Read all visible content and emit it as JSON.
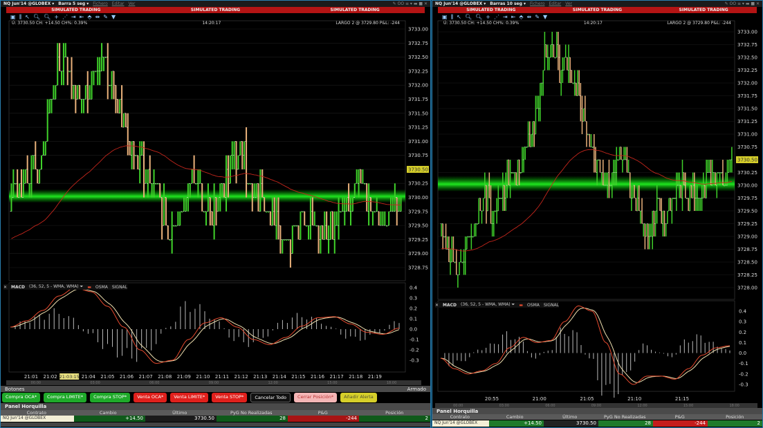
{
  "left": {
    "symbol": "NQ Jun'14 @GLOBEX ▾",
    "bar_size": "Barra 5 seg ▾",
    "menus": [
      "Fichero",
      "Editar",
      "Ver"
    ],
    "window_controls": "✎ OO ≡ ▾ ▬ ■ ✕",
    "sim_labels": [
      "SIMULATED TRADING",
      "SIMULATED TRADING",
      "SIMULATED TRADING"
    ],
    "info_quote": "Ú: 3730.50 CH: +14.50 CH%: 0.39%",
    "info_time": "14:20:17",
    "info_position": "LARGO 2 @ 3729.80  P&L: -244",
    "price_ticks": [
      "3733.00",
      "3732.75",
      "3732.50",
      "3732.25",
      "3732.00",
      "3731.75",
      "3731.50",
      "3731.25",
      "3731.00",
      "3730.75",
      "3730.50",
      "3730.25",
      "3730.00",
      "3729.75",
      "3729.50",
      "3729.25",
      "3729.00",
      "3728.75"
    ],
    "last_price_tag": "3730.50",
    "macd_ticks": [
      "0.4",
      "0.3",
      "0.2",
      "0.1",
      "0.0",
      "-0.1",
      "-0.2",
      "-0.3"
    ],
    "time_ticks": [
      "21:01",
      "21:02",
      "21:03:15",
      "21:04",
      "21:05",
      "21:06",
      "21:07",
      "21:08",
      "21:09",
      "21:10",
      "21:11",
      "21:12",
      "21:13",
      "21:14",
      "21:15",
      "21:16",
      "21:17",
      "21:18",
      "21:19"
    ],
    "scroll_ticks": [
      "00:00",
      "03:00",
      "06:00",
      "09:00",
      "12:00",
      "15:00",
      "18:00"
    ],
    "prices": [
      3729.75,
      3730.25,
      3730.5,
      3730.5,
      3731.5,
      3732.5,
      3732.25,
      3731.75,
      3732,
      3732.5,
      3732.25,
      3731.5,
      3731,
      3730.5,
      3730.25,
      3730,
      3729.25,
      3729.75,
      3730.25,
      3730,
      3729.75,
      3730,
      3730.5,
      3731,
      3730.25,
      3730,
      3729.75,
      3729.5,
      3729.25,
      3729.5,
      3729.5,
      3729.25,
      3729.5,
      3729.75,
      3730,
      3730.25,
      3729.75,
      3729.5,
      3729.75,
      3730
    ],
    "macd": [
      0.02,
      0.08,
      0.18,
      0.32,
      0.4,
      0.36,
      0.22,
      0.02,
      -0.2,
      -0.33,
      -0.3,
      -0.1,
      0.06,
      0.11,
      0.02,
      -0.1,
      -0.15,
      -0.08,
      0.03,
      0.11,
      0.12,
      0.05,
      -0.03,
      -0.05,
      0.01
    ]
  },
  "right": {
    "symbol": "NQ Jun'14 @GLOBEX ▾",
    "bar_size": "Barras 10 seg ▾",
    "menus": [
      "Fichero",
      "Editar",
      "Ver"
    ],
    "window_controls": "✎ OO ≡ ▾ ▬ ■ ✕",
    "sim_labels": [
      "SIMULATED TRADING",
      "SIMULATED TRADING",
      "SIMULATED TRADING"
    ],
    "info_quote": "Ú: 3730.50 CH: +14.50 CH%: 0.39%",
    "info_time": "14:20:17",
    "info_position": "LARGO 2 @ 3729.80  P&L: -244",
    "price_ticks": [
      "3733.00",
      "3732.75",
      "3732.50",
      "3732.25",
      "3732.00",
      "3731.75",
      "3731.50",
      "3731.25",
      "3731.00",
      "3730.75",
      "3730.50",
      "3730.25",
      "3730.00",
      "3729.75",
      "3729.50",
      "3729.25",
      "3729.00",
      "3728.75",
      "3728.50",
      "3728.25",
      "3728.00"
    ],
    "last_price_tag": "3730.50",
    "macd_ticks": [
      "0.4",
      "0.3",
      "0.2",
      "0.1",
      "0.0",
      "-0.1",
      "-0.2",
      "-0.3"
    ],
    "time_ticks": [
      "20:55",
      "21:00",
      "21:05",
      "21:10",
      "21:15"
    ],
    "scroll_ticks": [
      "00:00",
      "03:00",
      "06:00",
      "09:00",
      "12:00",
      "15:00",
      "18:00"
    ],
    "prices": [
      3729.25,
      3728.75,
      3728.5,
      3728.5,
      3729.0,
      3729.5,
      3729.75,
      3729.5,
      3729.75,
      3730.25,
      3730.0,
      3730.5,
      3731.0,
      3731.5,
      3732.5,
      3732.75,
      3732.25,
      3732.5,
      3732.0,
      3731.5,
      3731.0,
      3730.25,
      3730.0,
      3730.25,
      3730.75,
      3730.25,
      3729.75,
      3729.25,
      3729.0,
      3729.5,
      3729.25,
      3729.75,
      3730.0,
      3729.75,
      3729.75,
      3730.0,
      3730.25,
      3730.0,
      3730.25,
      3730.5
    ],
    "macd": [
      -0.05,
      -0.15,
      -0.2,
      -0.17,
      -0.1,
      0.05,
      0.15,
      0.1,
      0.12,
      0.3,
      0.45,
      0.4,
      0.1,
      -0.2,
      -0.3,
      -0.22,
      -0.22,
      -0.25,
      -0.15,
      -0.02,
      0.05,
      0.07
    ]
  },
  "indicator": {
    "name": "MACD",
    "params": "(36, 52, 5 - WMA, WMA) ⏷",
    "osma": "OSMA",
    "signal": "SIGNAL"
  },
  "botones": {
    "title": "Botones",
    "armed": "Armado",
    "buttons": [
      "Compra OCA*",
      "Compra LIMITE*",
      "Compra STOP*",
      "Venta OCA*",
      "Venta LIMITE*",
      "Venta STOP*",
      "Cancelar Todo",
      "Cerrar Posición*",
      "Añadir Alerta"
    ]
  },
  "panel": {
    "title": "Panel Horquilla",
    "columns": [
      "Contrato",
      "Cambio",
      "Último",
      "PyG No Realizadas",
      "P&G",
      "Posición"
    ],
    "row": {
      "contract": "NQ Jun'14 @GLOBEX",
      "change": "+14.50",
      "last": "3730.50",
      "unrealized": "28",
      "pnl": "-244",
      "position": "2"
    }
  },
  "colors": {
    "up": "#3fd12a",
    "down": "#e8b07a",
    "sim": "#b41414",
    "macd": "#e64a2e",
    "signal": "#f0e0b0"
  }
}
